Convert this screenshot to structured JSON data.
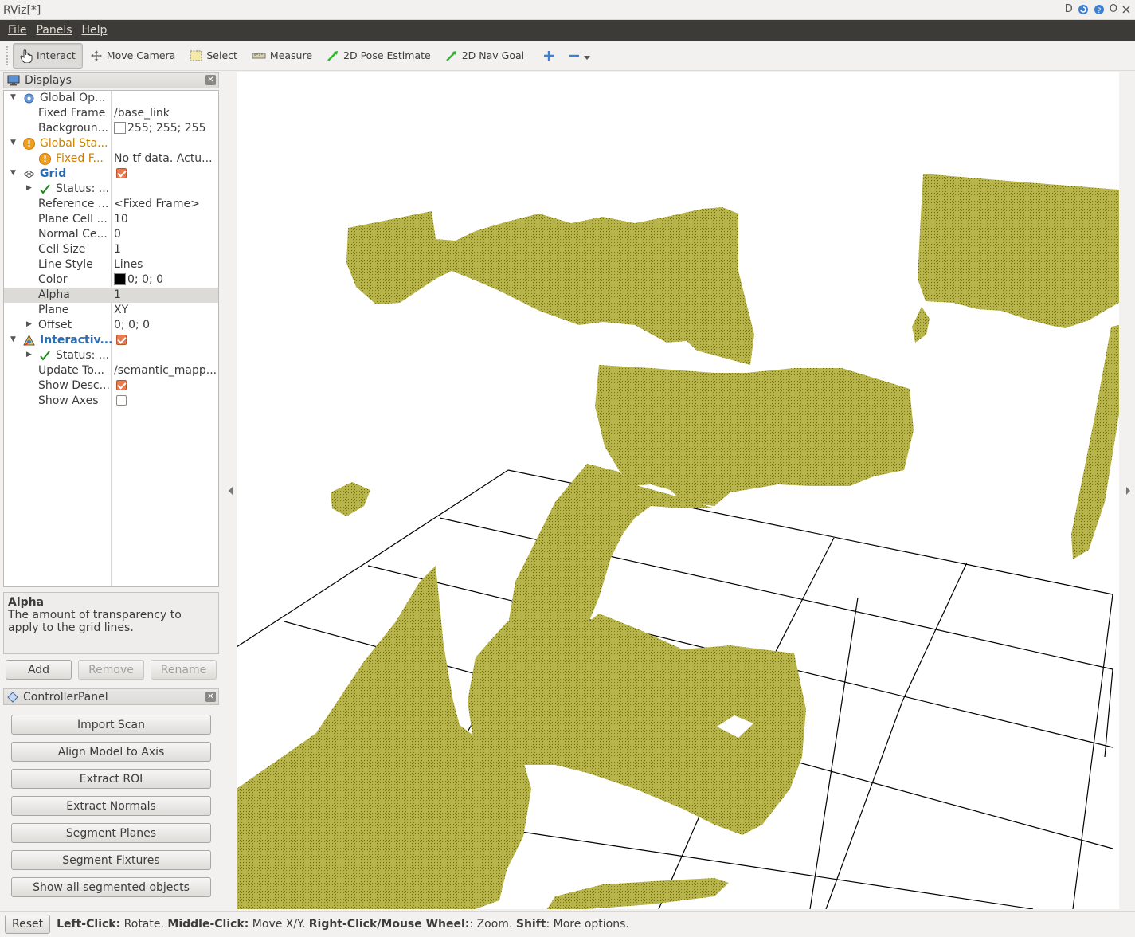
{
  "window": {
    "title": "RViz[*]",
    "controls_text": "D",
    "close_text": "O"
  },
  "menu": [
    {
      "label": "File"
    },
    {
      "label": "Panels"
    },
    {
      "label": "Help"
    }
  ],
  "toolbar": {
    "interact": "Interact",
    "move_camera": "Move Camera",
    "select": "Select",
    "measure": "Measure",
    "pose_estimate": "2D Pose Estimate",
    "nav_goal": "2D Nav Goal",
    "add_icon": "plus-icon",
    "remove_icon": "minus-icon"
  },
  "displays_panel": {
    "title": "Displays",
    "rows": [
      {
        "label": "Global Op...",
        "value": ""
      },
      {
        "label": "Fixed Frame",
        "value": "/base_link"
      },
      {
        "label": "Backgroun...",
        "value": "255; 255; 255"
      },
      {
        "label": "Global Sta...",
        "value": ""
      },
      {
        "label": "Fixed F...",
        "value": "No tf data.  Actu..."
      },
      {
        "label": "Grid",
        "value": ""
      },
      {
        "label": "Status: ...",
        "value": ""
      },
      {
        "label": "Reference ...",
        "value": "<Fixed Frame>"
      },
      {
        "label": "Plane Cell ...",
        "value": "10"
      },
      {
        "label": "Normal Ce...",
        "value": "0"
      },
      {
        "label": "Cell Size",
        "value": "1"
      },
      {
        "label": "Line Style",
        "value": "Lines"
      },
      {
        "label": "Color",
        "value": "0; 0; 0"
      },
      {
        "label": "Alpha",
        "value": "1"
      },
      {
        "label": "Plane",
        "value": "XY"
      },
      {
        "label": "Offset",
        "value": "0; 0; 0"
      },
      {
        "label": "Interactiv...",
        "value": ""
      },
      {
        "label": "Status: ...",
        "value": ""
      },
      {
        "label": "Update To...",
        "value": "/semantic_mapp..."
      },
      {
        "label": "Show Desc...",
        "value": ""
      },
      {
        "label": "Show Axes",
        "value": ""
      }
    ],
    "colors": {
      "background_swatch": "#ffffff",
      "grid_color_swatch": "#000000",
      "warning": "#c98000",
      "enabled_label": "#2a6cb5"
    }
  },
  "help": {
    "title": "Alpha",
    "text": "The amount of transparency to apply to the grid lines."
  },
  "display_buttons": {
    "add": "Add",
    "remove": "Remove",
    "rename": "Rename"
  },
  "controller_panel": {
    "title": "ControllerPanel",
    "buttons": [
      {
        "label": "Import Scan"
      },
      {
        "label": "Align Model to Axis"
      },
      {
        "label": "Extract ROI"
      },
      {
        "label": "Extract Normals"
      },
      {
        "label": "Segment Planes"
      },
      {
        "label": "Segment Fixtures"
      },
      {
        "label": "Show all segmented objects"
      }
    ]
  },
  "statusbar": {
    "reset": "Reset",
    "left_click_key": "Left-Click:",
    "left_click_val": " Rotate. ",
    "middle_click_key": "Middle-Click:",
    "middle_click_val": " Move X/Y. ",
    "right_click_key": "Right-Click/Mouse Wheel:",
    "right_click_val": ": Zoom. ",
    "shift_key": "Shift",
    "shift_val": ": More options."
  },
  "viewport": {
    "point_cloud_color": "#b5b14a",
    "grid_line_color": "#000000",
    "background": "#ffffff"
  }
}
